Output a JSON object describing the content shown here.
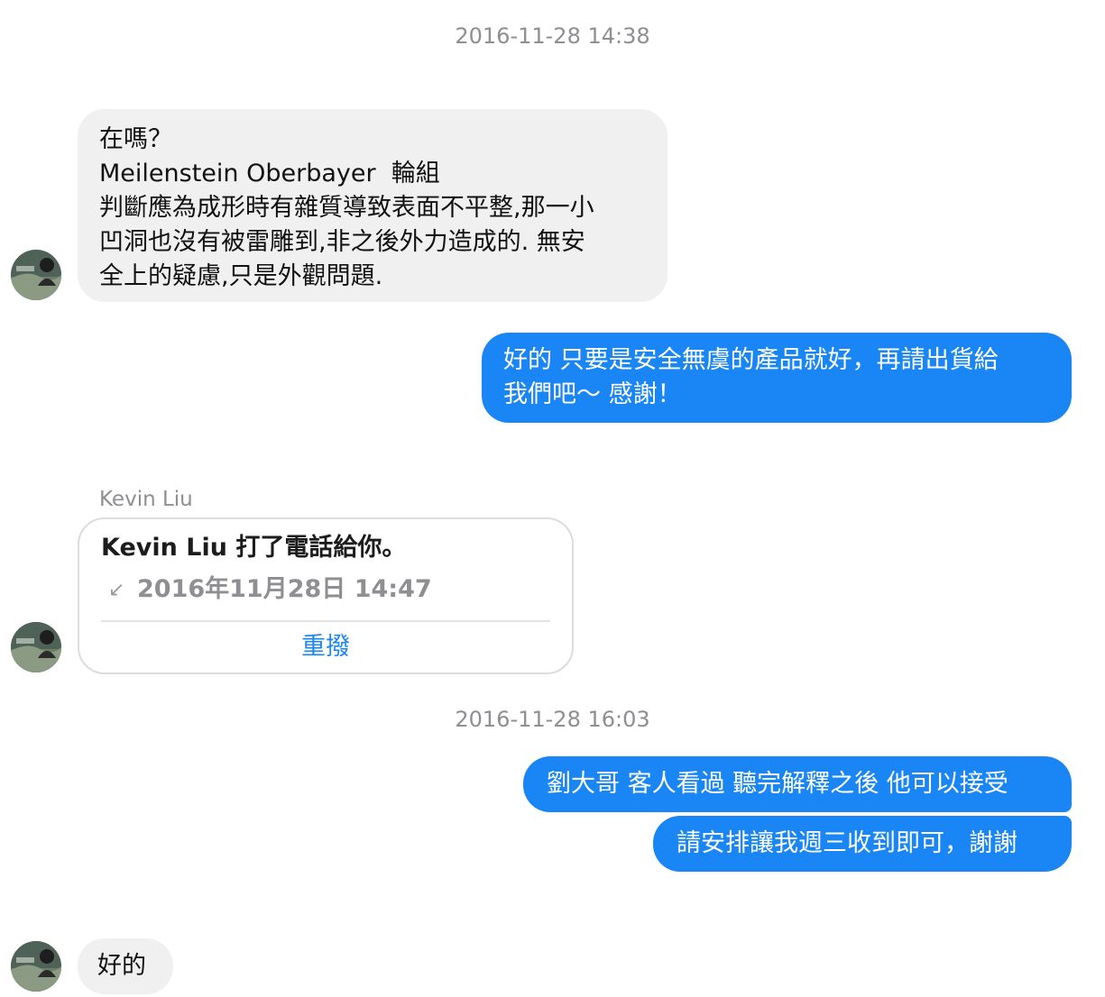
{
  "conversation": {
    "timestamps": [
      "2016-11-28 14:38",
      "2016-11-28 16:03"
    ],
    "contact_name": "Kevin Liu",
    "messages": {
      "m1": "在嗎？\nMeilenstein Oberbayer  輪組\n判斷應為成形時有雜質導致表面不平整,那一小\n凹洞也沒有被雷雕到,非之後外力造成的. 無安\n全上的疑慮,只是外觀問題.",
      "m2": "好的 只要是安全無虞的產品就好，再請出貨給\n我們吧～ 感謝！",
      "m3": "劉大哥 客人看過 聽完解釋之後 他可以接受",
      "m4": "請安排讓我週三收到即可，謝謝",
      "m5": "好的"
    },
    "call": {
      "title": "Kevin Liu 打了電話給你。",
      "arrow": "↙",
      "time": "2016年11月28日 14:47",
      "redial_label": "重撥"
    }
  },
  "colors": {
    "outgoing_bubble": "#1a86f5",
    "incoming_bubble": "#f0f0f0",
    "meta_text": "#8e8e93"
  }
}
